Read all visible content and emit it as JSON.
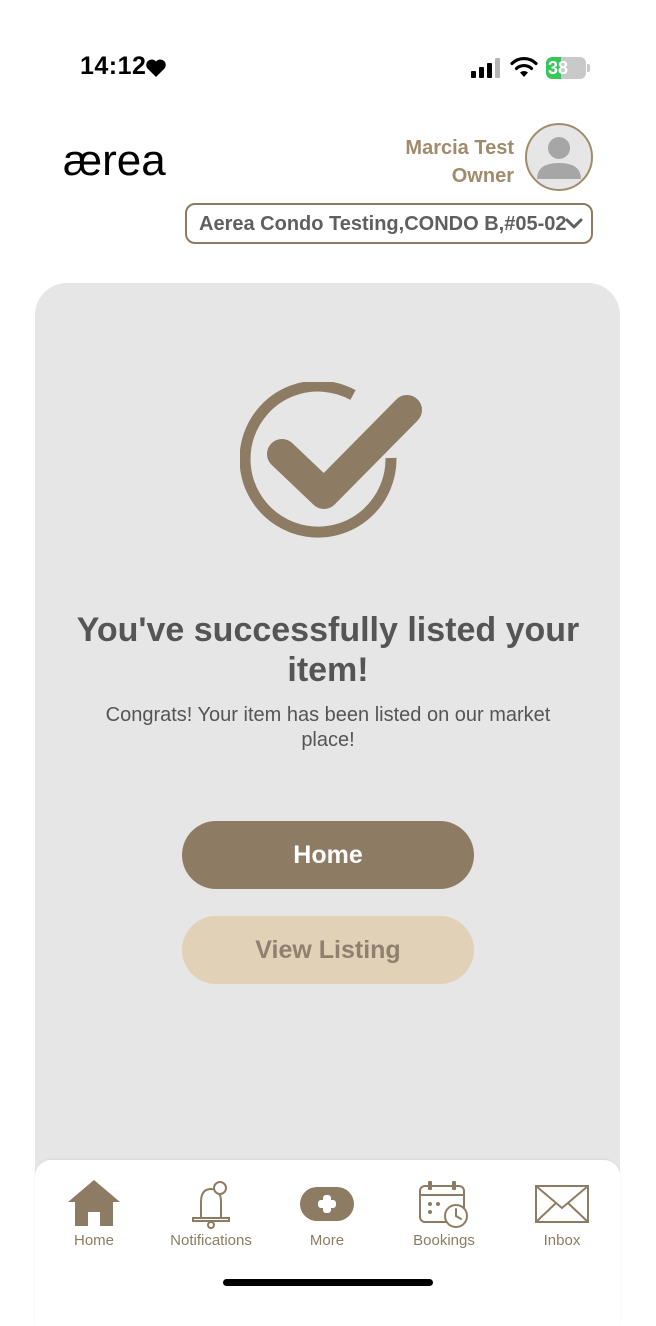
{
  "status_bar": {
    "time": "14:12",
    "battery": "38",
    "battery_level": 0.38,
    "icons": [
      "heart-icon",
      "cellular-signal-icon",
      "wifi-icon",
      "battery-charging-icon"
    ]
  },
  "header": {
    "logo_text": "ærea",
    "user_name": "Marcia Test",
    "user_role": "Owner",
    "unit_selector": "Aerea Condo Testing,CONDO B,#05-02"
  },
  "main": {
    "title": "You've successfully listed your item!",
    "message": "Congrats! Your item has been listed on our market place!",
    "home_button": "Home",
    "view_listing_button": "View Listing"
  },
  "bottom_nav": {
    "items": [
      {
        "label": "Home",
        "icon": "home-icon"
      },
      {
        "label": "Notifications",
        "icon": "bell-icon"
      },
      {
        "label": "More",
        "icon": "plus-icon"
      },
      {
        "label": "Bookings",
        "icon": "calendar-icon"
      },
      {
        "label": "Inbox",
        "icon": "envelope-icon"
      }
    ]
  },
  "colors": {
    "brand": "#8d7c63",
    "brand_light": "#e1d1b6",
    "card_bg": "#e6e6e6",
    "text": "#555555",
    "battery_green": "#35c759"
  }
}
